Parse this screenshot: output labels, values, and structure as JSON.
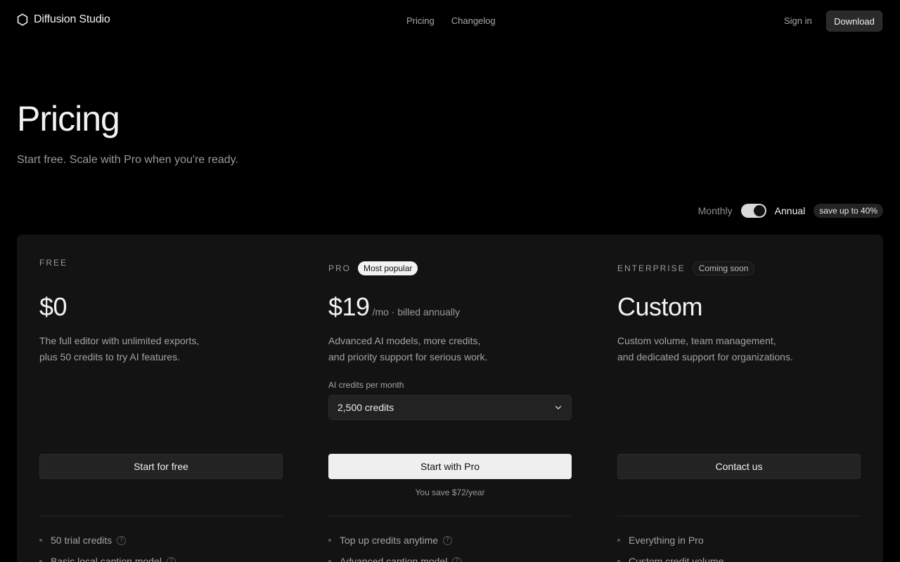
{
  "header": {
    "brand": "Diffusion Studio",
    "nav": [
      "Pricing",
      "Changelog"
    ],
    "sign_in": "Sign in",
    "download": "Download"
  },
  "hero": {
    "title": "Pricing",
    "subtitle": "Start free. Scale with Pro when you're ready."
  },
  "billing": {
    "monthly": "Monthly",
    "annual": "Annual",
    "selected": "Annual",
    "save_badge": "save up to 40%"
  },
  "plans": {
    "free": {
      "label": "FREE",
      "price": "$0",
      "desc_line1": "The full editor with unlimited exports,",
      "desc_line2": "plus 50 credits to try AI features.",
      "button": "Start for free",
      "features": [
        "50 trial credits",
        "Basic local caption model"
      ]
    },
    "pro": {
      "label": "PRO",
      "badge": "Most popular",
      "price": "$19",
      "price_note": "/mo · billed annually",
      "desc_line1": "Advanced AI models, more credits,",
      "desc_line2": "and priority support for serious work.",
      "credits_label": "AI credits per month",
      "credits_value": "2,500 credits",
      "button": "Start with Pro",
      "save_note": "You save $72/year",
      "features": [
        "Top up credits anytime",
        "Advanced caption model"
      ]
    },
    "enterprise": {
      "label": "ENTERPRISE",
      "badge": "Coming soon",
      "price": "Custom",
      "desc_line1": "Custom volume, team management,",
      "desc_line2": "and dedicated support for organizations.",
      "button": "Contact us",
      "features": [
        "Everything in Pro",
        "Custom credit volume"
      ]
    }
  },
  "icons": {
    "logo": "hexagon-logo-icon",
    "chevron": "chevron-down-icon",
    "help": "help-circle-icon"
  }
}
